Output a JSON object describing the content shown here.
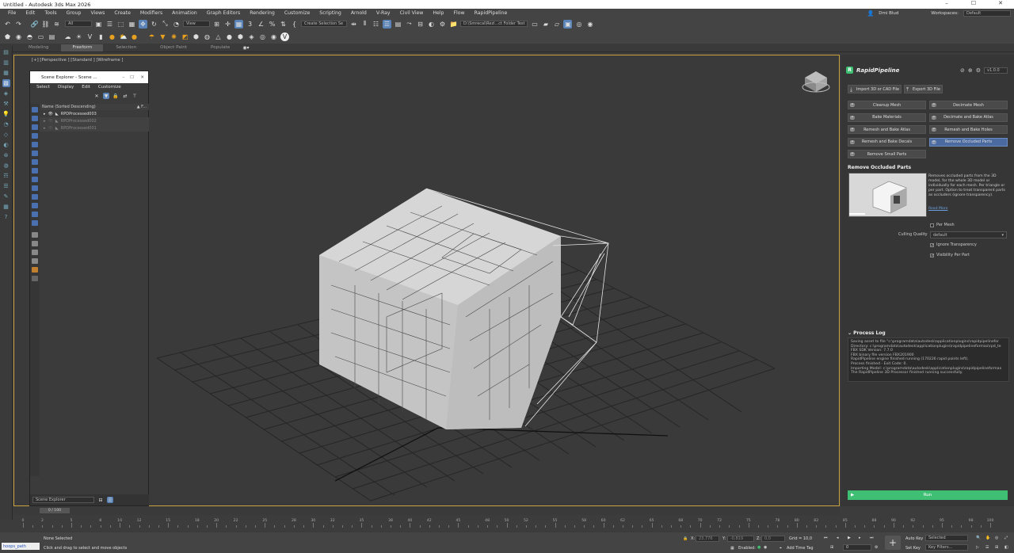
{
  "window": {
    "title": "Untitled - Autodesk 3ds Max 2026",
    "ctrl_min": "–",
    "ctrl_max": "☐",
    "ctrl_close": "✕"
  },
  "menu": {
    "items": [
      "File",
      "Edit",
      "Tools",
      "Group",
      "Views",
      "Create",
      "Modifiers",
      "Animation",
      "Graph Editors",
      "Rendering",
      "Customize",
      "Scripting",
      "Arnold",
      "V-Ray",
      "Civil View",
      "Help",
      "Flow",
      "RapidPipeline"
    ],
    "user": "Dmi Blud",
    "workspaces_label": "Workspaces:",
    "workspace": "Default"
  },
  "toolbar": {
    "filter_dropdown": "All",
    "ref_coord": "View",
    "named_selection": "Create Selection Se",
    "project_path": "D:\\Smrecal\\Rezl...ct Folder Test"
  },
  "ribbon_tabs": [
    "Modeling",
    "Freeform",
    "Selection",
    "Object Paint",
    "Populate"
  ],
  "ribbon_active": "Freeform",
  "viewport": {
    "label": "[+] [Perspective ] [Standard ] [Wireframe ]"
  },
  "scene_explorer": {
    "title": "Scene Explorer - Scene ...",
    "menu": [
      "Select",
      "Display",
      "Edit",
      "Customize"
    ],
    "column_header": "Name (Sorted Descending)",
    "column_header_right": "▲ F...",
    "rows": [
      "RPDProcessed003",
      "RPDProcessed002",
      "RPDProcessed001"
    ],
    "footer_dropdown": "Scene Explorer"
  },
  "rapid_pipeline": {
    "title": "RapidPipeline",
    "version": "v1.0.0",
    "import_btn": "Import 3D or CAD File",
    "export_btn": "Export 3D File",
    "buttons_left": [
      "Cleanup Mesh",
      "Bake Materials",
      "Remesh and Bake Atlas",
      "Remesh and Bake Decals",
      "Remove Small Parts"
    ],
    "buttons_right": [
      "Decimate Mesh",
      "Decimate and Bake Atlas",
      "Remesh and Bake Holes",
      "Remove Occluded Parts"
    ],
    "section_title": "Remove Occluded Parts",
    "description": "Removes occluded parts from the 3D model, for the whole 3D model or individually for each mesh. Per triangle or per part. Option to treat transparent parts as occluders (ignore transparency).",
    "read_more": "Read More",
    "per_mesh_label": "Per Mesh",
    "culling_label": "Culling Quality",
    "culling_value": "default",
    "ignore_transparency_label": "Ignore Transparency",
    "visibility_per_part_label": "Visibility Per Part",
    "log_title": "Process Log",
    "log_lines": [
      "Saving asset to file \"c:\\programdata\\autodesk\\applicationplugins\\rapidpipelinefor",
      "Directory: c:\\programdata\\autodesk\\applicationplugins\\rapidpipelineformax\\rpd_te",
      "FBX SDK Version: 7.7.0",
      "FBX binary file version FBX201900",
      "RapidPipeline engine finished running (170226 rapid points left).",
      "Process finished - Exit Code: 0.",
      "Importing Model: c:\\programdata\\autodesk\\applicationplugins\\rapidpipelineformax",
      "The RapidPipeline 3D Processor finished running successfully."
    ],
    "run_label": "Run"
  },
  "timeline": {
    "slider": "0 / 100",
    "ticks": [
      "0",
      "2",
      "5",
      "8",
      "10",
      "12",
      "15",
      "18",
      "20",
      "22",
      "25",
      "28",
      "30",
      "32",
      "35",
      "38",
      "40",
      "42",
      "45",
      "48",
      "50",
      "52",
      "55",
      "58",
      "60",
      "62",
      "65",
      "68",
      "70",
      "72",
      "75",
      "78",
      "80",
      "82",
      "85",
      "88",
      "90",
      "92",
      "95",
      "98",
      "100"
    ]
  },
  "status": {
    "script_box": "hoops_path",
    "selection": "None Selected",
    "prompt": "Click and drag to select and move objects",
    "x_label": "X:",
    "x_val": "23,776",
    "y_label": "Y:",
    "y_val": "-0,819",
    "z_label": "Z:",
    "z_val": "0,0",
    "grid": "Grid = 10,0",
    "enabled": "Enabled:",
    "add_time_tag": "Add Time Tag",
    "auto_key": "Auto Key",
    "set_key": "Set Key",
    "selected": "Selected",
    "key_filters": "Key Filters...",
    "frame": "0"
  },
  "accent": {
    "rapid_green": "#3fbf73",
    "select_blue": "#4a6aa0",
    "viewport_border": "#c8a040"
  }
}
